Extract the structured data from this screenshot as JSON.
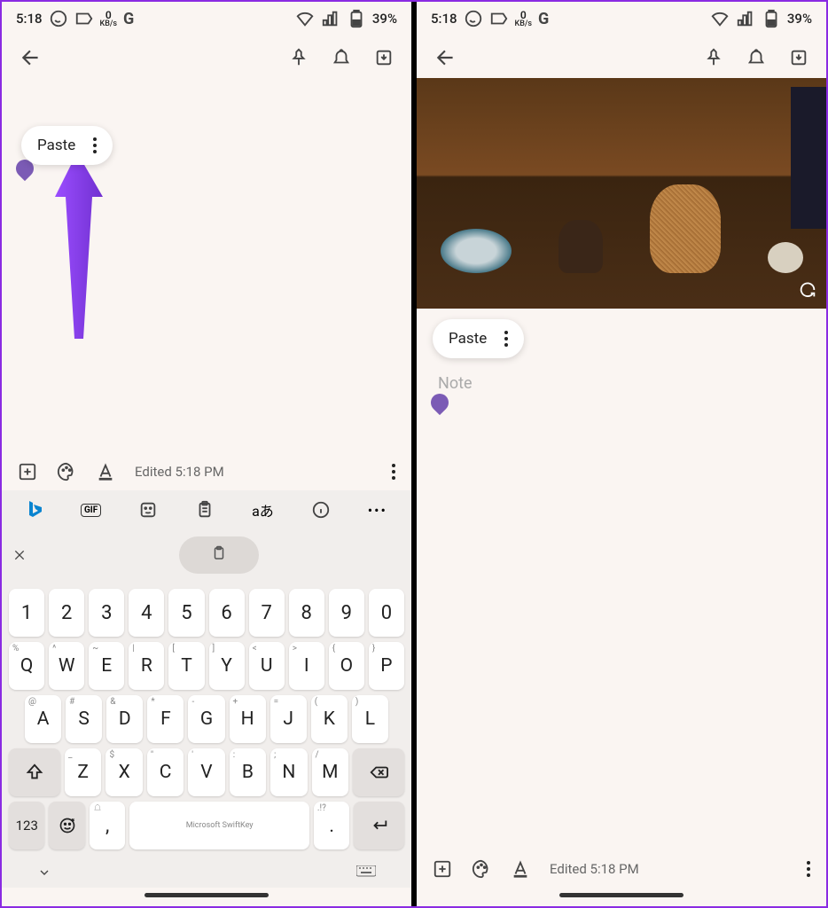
{
  "status_bar": {
    "time": "5:18",
    "data_rate": {
      "value": "0",
      "unit": "KB/s"
    },
    "battery": "39%",
    "icons": [
      "whatsapp",
      "tag",
      "google",
      "wifi",
      "signal",
      "battery"
    ]
  },
  "app_bar": {
    "back": "back-arrow",
    "actions": [
      "pin",
      "reminder",
      "archive"
    ]
  },
  "context_menu": {
    "paste": "Paste"
  },
  "note": {
    "placeholder": "Note"
  },
  "toolbar": {
    "edited": "Edited 5:18 PM"
  },
  "keyboard": {
    "brand": "Microsoft SwiftKey",
    "row_numbers": [
      "1",
      "2",
      "3",
      "4",
      "5",
      "6",
      "7",
      "8",
      "9",
      "0"
    ],
    "row_top": [
      {
        "main": "Q",
        "alt": "%"
      },
      {
        "main": "W",
        "alt": "^"
      },
      {
        "main": "E",
        "alt": "~"
      },
      {
        "main": "R",
        "alt": "|"
      },
      {
        "main": "T",
        "alt": "["
      },
      {
        "main": "Y",
        "alt": "]"
      },
      {
        "main": "U",
        "alt": "<"
      },
      {
        "main": "I",
        "alt": ">"
      },
      {
        "main": "O",
        "alt": "{"
      },
      {
        "main": "P",
        "alt": "}"
      }
    ],
    "row_mid": [
      {
        "main": "A",
        "alt": "@"
      },
      {
        "main": "S",
        "alt": "#"
      },
      {
        "main": "D",
        "alt": "&"
      },
      {
        "main": "F",
        "alt": "*"
      },
      {
        "main": "G",
        "alt": "-"
      },
      {
        "main": "H",
        "alt": "+"
      },
      {
        "main": "J",
        "alt": "="
      },
      {
        "main": "K",
        "alt": "("
      },
      {
        "main": "L",
        "alt": ")"
      }
    ],
    "row_bot": [
      {
        "main": "Z",
        "alt": "_"
      },
      {
        "main": "X",
        "alt": "$"
      },
      {
        "main": "C",
        "alt": "\""
      },
      {
        "main": "V",
        "alt": "'"
      },
      {
        "main": "B",
        "alt": ":"
      },
      {
        "main": "N",
        "alt": ";"
      },
      {
        "main": "M",
        "alt": "/"
      }
    ],
    "fn_123": "123",
    "comma": ",",
    "period": ".",
    "period_alt": ".!?"
  }
}
